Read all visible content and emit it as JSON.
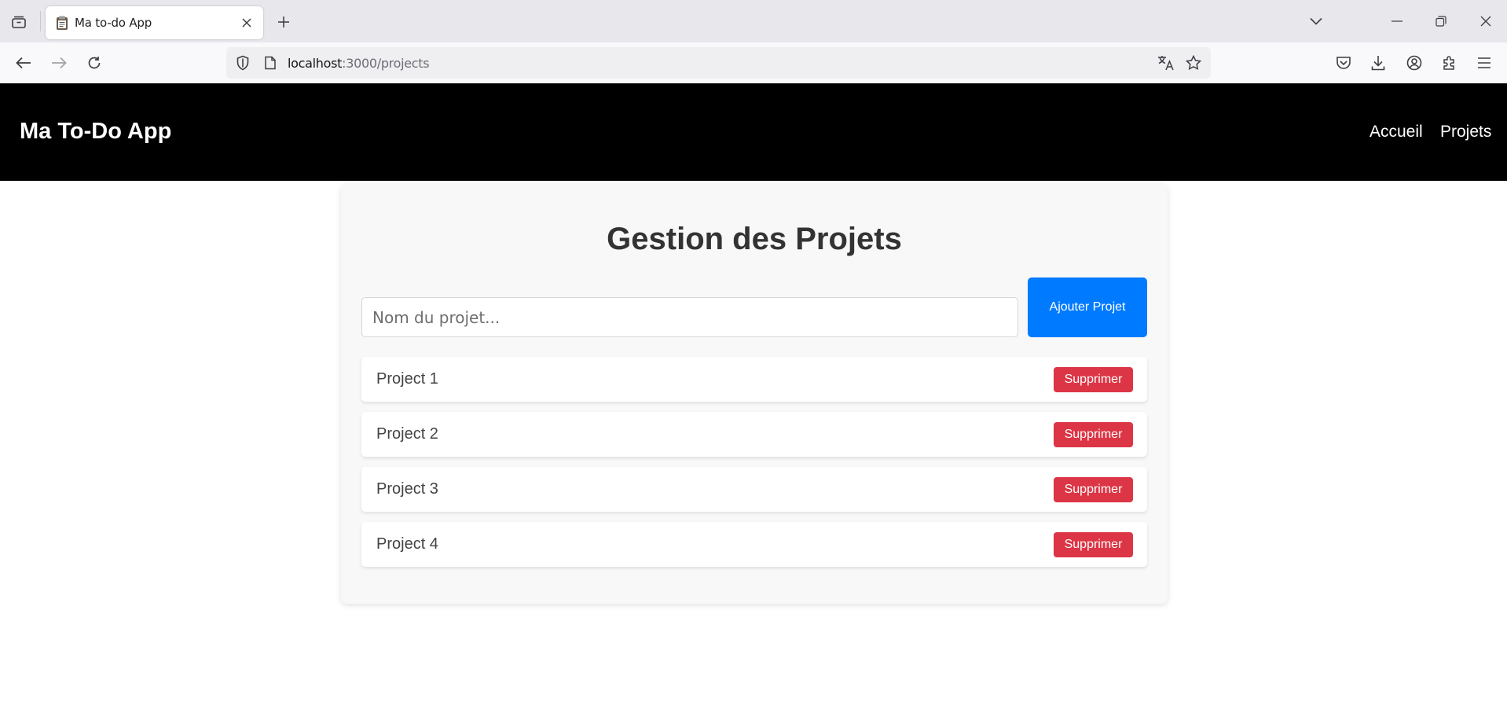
{
  "browser": {
    "tab_title": "Ma to-do App",
    "url_host": "localhost",
    "url_path": ":3000/projects"
  },
  "header": {
    "brand": "Ma To-Do App",
    "nav": [
      {
        "label": "Accueil"
      },
      {
        "label": "Projets"
      }
    ]
  },
  "main": {
    "title": "Gestion des Projets",
    "input_placeholder": "Nom du projet...",
    "add_button_label": "Ajouter Projet",
    "projects": [
      {
        "name": "Project 1",
        "delete_label": "Supprimer"
      },
      {
        "name": "Project 2",
        "delete_label": "Supprimer"
      },
      {
        "name": "Project 3",
        "delete_label": "Supprimer"
      },
      {
        "name": "Project 4",
        "delete_label": "Supprimer"
      }
    ]
  },
  "colors": {
    "header_bg": "#000000",
    "primary": "#007bff",
    "danger": "#dc3545",
    "card_bg": "#f8f8f8"
  }
}
